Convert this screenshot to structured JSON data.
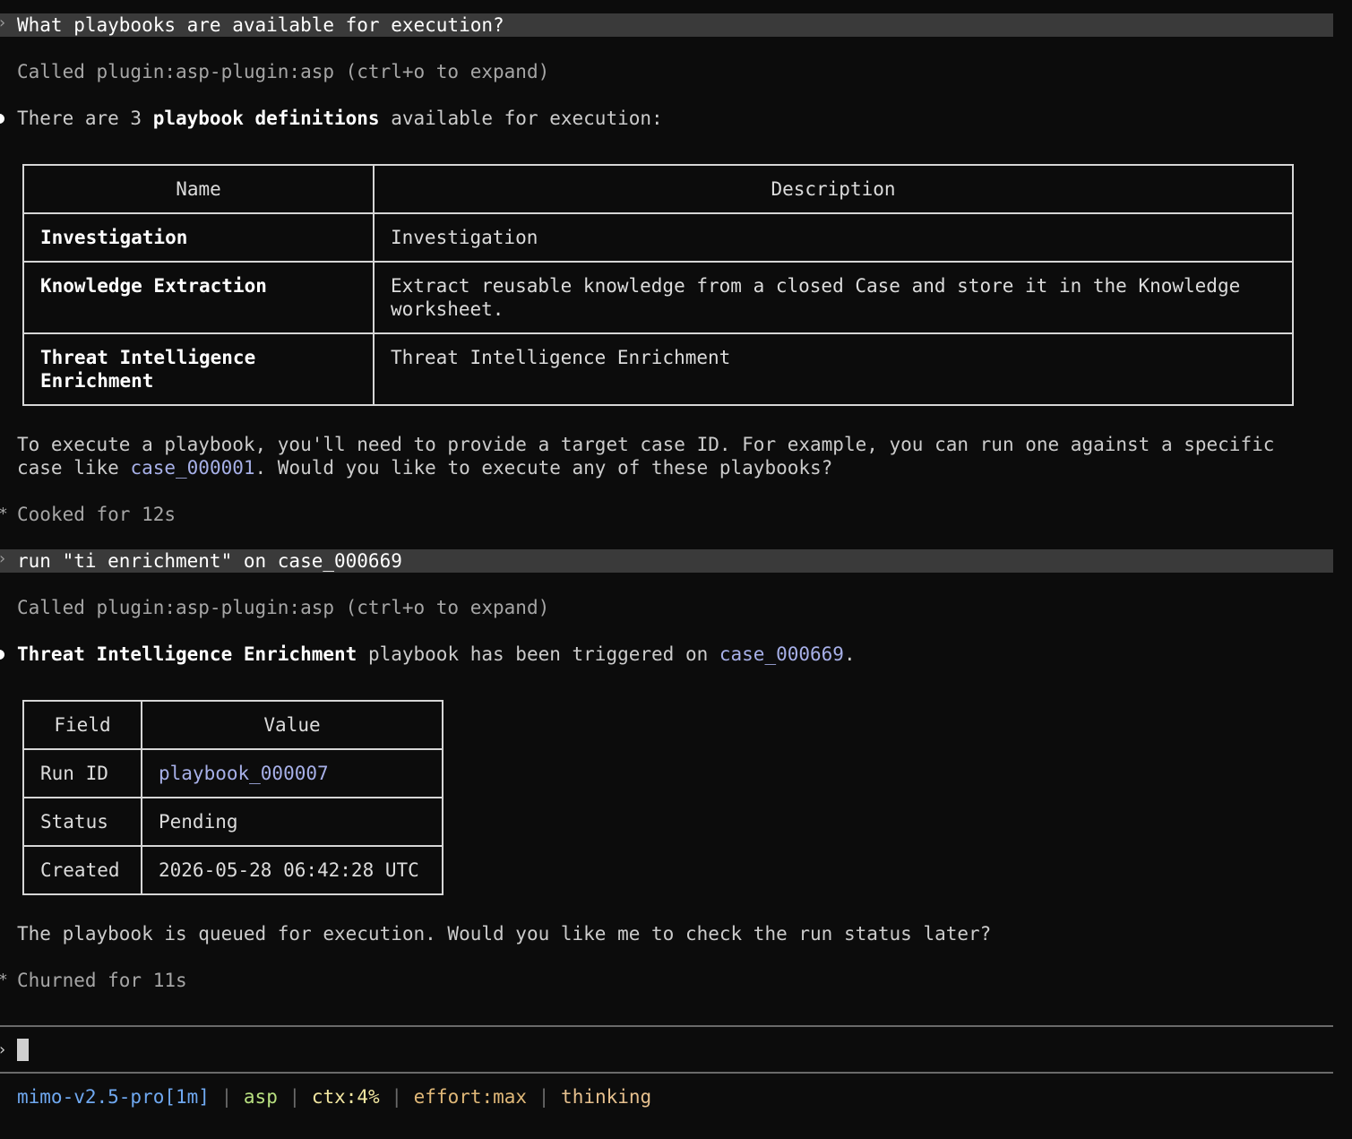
{
  "turn1": {
    "user_prompt": "What playbooks are available for execution?",
    "tool_call": "Called plugin:asp-plugin:asp (ctrl+o to expand)",
    "reply_intro": {
      "pre": "There are 3 ",
      "bold": "playbook definitions",
      "post": " available for execution:"
    },
    "table": {
      "headers": [
        "Name",
        "Description"
      ],
      "rows": [
        {
          "name": "Investigation",
          "description": "Investigation"
        },
        {
          "name": "Knowledge Extraction",
          "description": "Extract reusable knowledge from a closed Case and store it in the Knowledge worksheet."
        },
        {
          "name": "Threat Intelligence Enrichment",
          "description": "Threat Intelligence Enrichment"
        }
      ]
    },
    "followup_line1": "To execute a playbook, you'll need to provide a target case ID. For example, you can run one against a specific",
    "followup_line2_pre": "case like ",
    "followup_line2_link": "case_000001",
    "followup_line2_post": ". Would you like to execute any of these playbooks?",
    "timing": "Cooked for 12s"
  },
  "turn2": {
    "user_prompt": "run \"ti enrichment\" on case_000669",
    "tool_call": "Called plugin:asp-plugin:asp (ctrl+o to expand)",
    "reply_intro": {
      "bold": "Threat Intelligence Enrichment",
      "mid": " playbook has been triggered on ",
      "link": "case_000669",
      "post": "."
    },
    "table": {
      "headers": [
        "Field",
        "Value"
      ],
      "rows": [
        {
          "field": "Run ID",
          "value": "playbook_000007"
        },
        {
          "field": "Status",
          "value": "Pending"
        },
        {
          "field": "Created",
          "value": "2026-05-28 06:42:28 UTC"
        }
      ]
    },
    "followup": "The playbook is queued for execution. Would you like me to check the run status later?",
    "timing": "Churned for 11s"
  },
  "input": {
    "value": ""
  },
  "status_bar": {
    "model": "mimo-v2.5-pro[1m]",
    "project": "asp",
    "ctx": "ctx:4%",
    "effort": "effort:max",
    "mode": "thinking",
    "separator": "|"
  },
  "colors": {
    "background": "#0c0c0c",
    "prompt_bar": "#3a3a3a",
    "link": "#a7b0e8",
    "model": "#6fa8f0",
    "project": "#b8e080",
    "ctx": "#f2e6a0",
    "effort": "#e0b878"
  },
  "icons": {
    "prompt": "chevron-right-icon",
    "bullet": "bullet-dot-icon",
    "timing": "asterisk-icon"
  }
}
